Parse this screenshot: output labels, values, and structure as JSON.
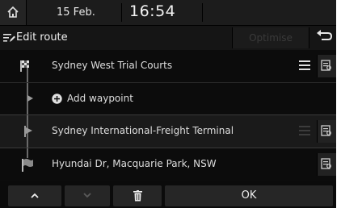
{
  "status": {
    "date": "15 Feb.",
    "time": "16:54"
  },
  "header": {
    "title": "Edit route",
    "optimise_label": "Optimise"
  },
  "route": {
    "items": [
      {
        "label": "Sydney West Trial Courts",
        "type": "start"
      },
      {
        "label": "Add waypoint",
        "type": "add"
      },
      {
        "label": "Sydney International-Freight Terminal",
        "type": "waypoint"
      },
      {
        "label": "Hyundai Dr, Macquarie Park, NSW",
        "type": "destination"
      }
    ]
  },
  "footer": {
    "ok_label": "OK"
  },
  "colors": {
    "background": "#0b0b0b",
    "row_selected": "#1a1a1a",
    "button": "#262626",
    "text": "#e6e6e6",
    "disabled_text": "#3a3a3a"
  }
}
